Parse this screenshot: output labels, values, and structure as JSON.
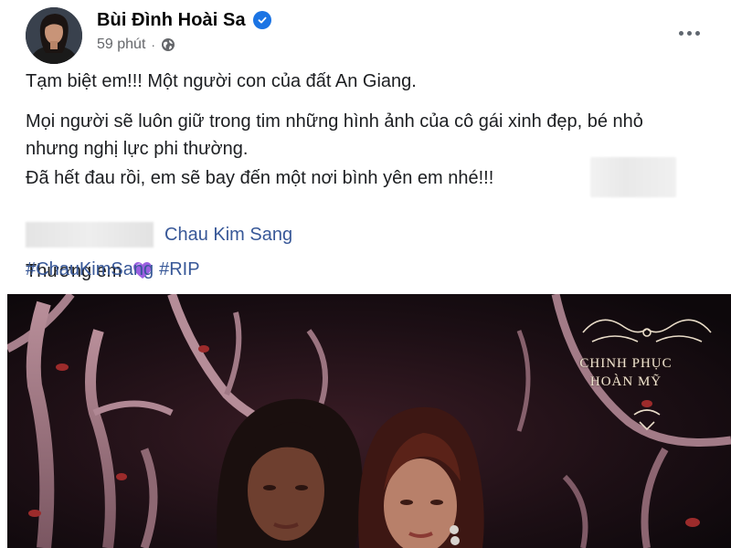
{
  "post": {
    "author": {
      "name": "Bùi Đình Hoài Sa",
      "verified": true
    },
    "meta": {
      "time": "59 phút",
      "separator": "·",
      "privacy_icon": "globe-icon"
    },
    "more_icon": "more-horizontal-icon",
    "text": {
      "line1": "Tạm biệt em!!! Một người con của đất An Giang.",
      "line2": "Mọi người sẽ luôn giữ trong tim những hình ảnh của cô gái xinh đẹp, bé nhỏ nhưng nghị lực phi thường.",
      "line3": "Đã hết đau rồi, em sẽ bay đến một nơi bình yên em nhé!!!",
      "mention": "Chau Kim Sang",
      "line5": "Thương em",
      "emoji": "purple-heart-icon"
    },
    "hashtags": [
      "#ChauKimSang",
      "#RIP"
    ],
    "photo": {
      "brand_line1": "CHINH PHỤC",
      "brand_line2": "HOÀN MỸ"
    }
  },
  "colors": {
    "link": "#385898",
    "verified": "#1b74e4",
    "meta_text": "#65676b",
    "heart": "#8b4fd1"
  }
}
